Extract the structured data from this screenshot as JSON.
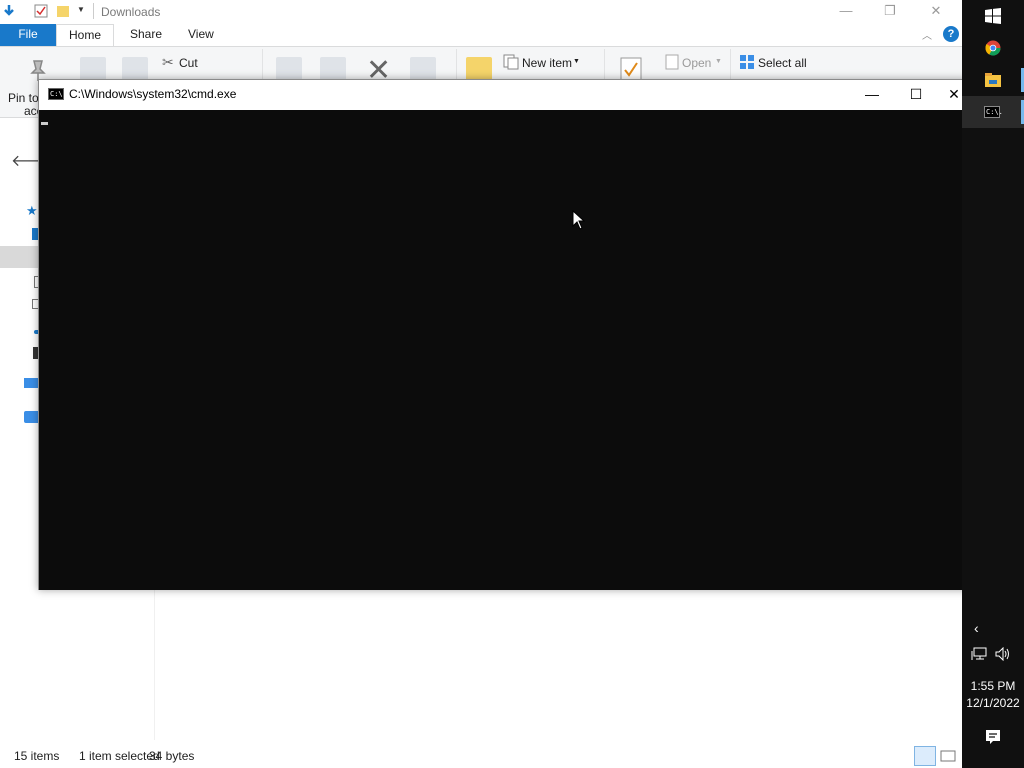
{
  "explorer": {
    "title": "Downloads",
    "tabs": {
      "file": "File",
      "home": "Home",
      "share": "Share",
      "view": "View"
    },
    "ribbon": {
      "pin_label": "Pin to",
      "pin_label2": "acc",
      "cut_label": "Cut",
      "new_item_label": "New item",
      "open_label": "Open",
      "select_all_label": "Select all"
    },
    "status": {
      "items_count": "15 items",
      "selected": "1 item selected",
      "size": "34 bytes"
    }
  },
  "cmd": {
    "title": "C:\\Windows\\system32\\cmd.exe",
    "icon_text": "C:\\.",
    "console_bg": "#0c0c0c"
  },
  "taskbar": {
    "time": "1:55 PM",
    "date": "12/1/2022",
    "apps": [
      "windows-start-icon",
      "chrome-icon",
      "file-explorer-icon",
      "cmd-icon"
    ]
  },
  "colors": {
    "file_tab": "#1979ca",
    "taskbar": "#101010",
    "accent": "#76b9ed"
  }
}
